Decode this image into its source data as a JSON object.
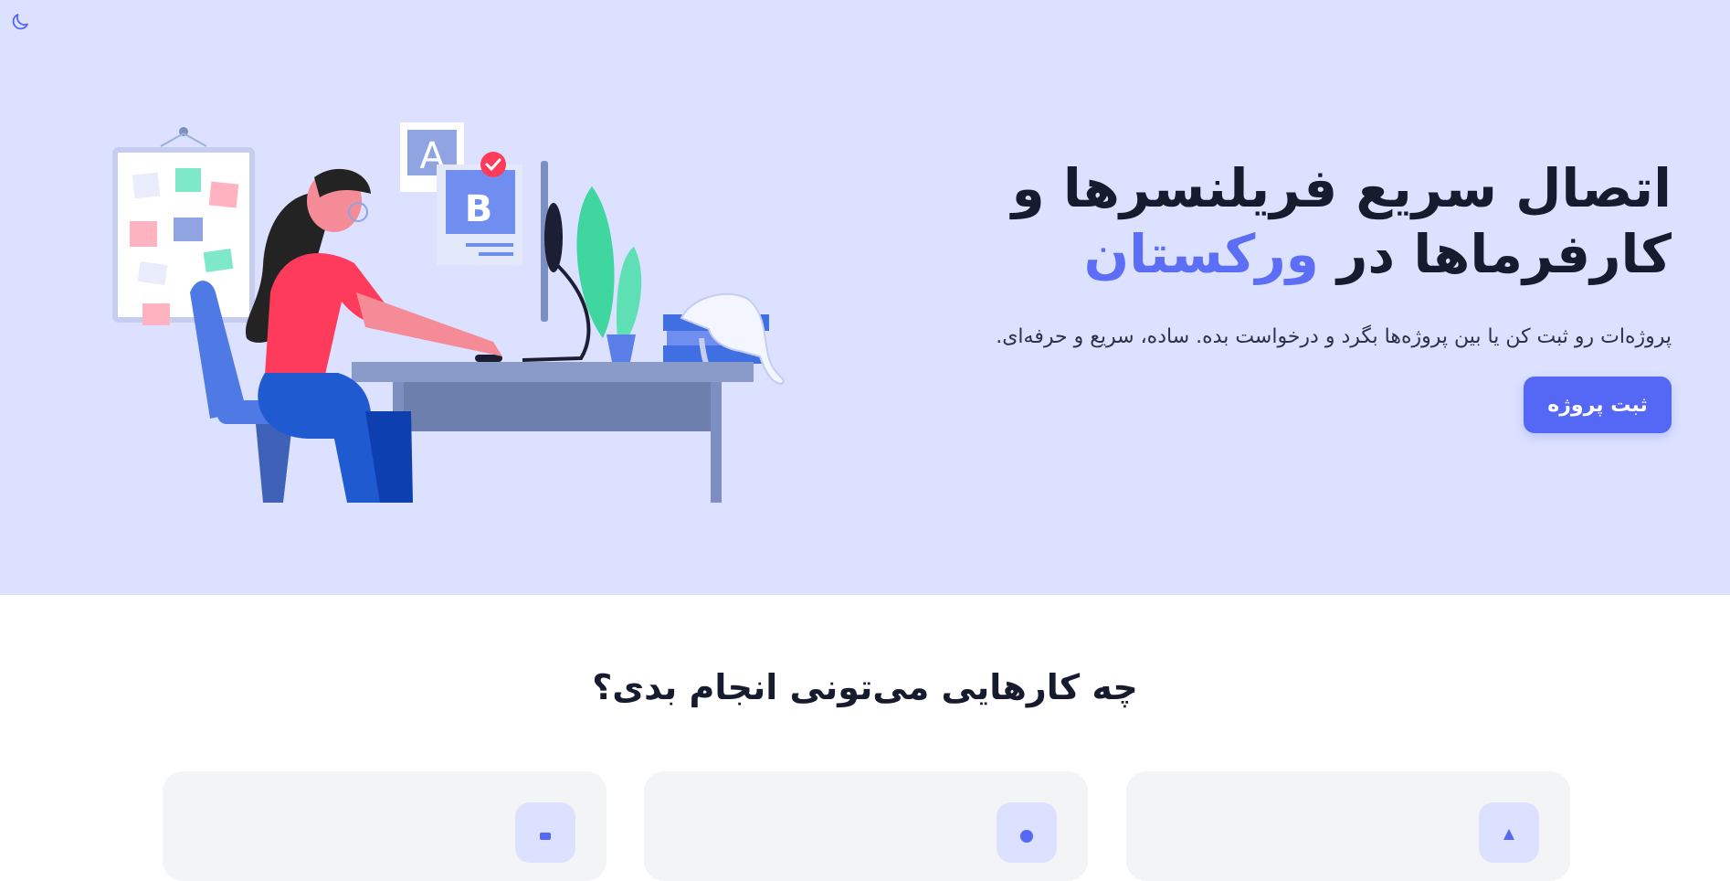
{
  "theme_toggle": {
    "icon": "moon-icon"
  },
  "hero": {
    "title_line1": "اتصال سریع فریلنسرها و",
    "title_line2_prefix": "کارفرماها در",
    "title_brand": "ورکستان",
    "subtitle": "پروژه‌ات رو ثبت کن یا بین پروژه‌ها بگرد و درخواست بده. ساده، سریع و حرفه‌ای.",
    "cta_label": "ثبت پروژه"
  },
  "features": {
    "title": "چه کارهایی می‌تونی انجام بدی؟"
  },
  "colors": {
    "hero_bg": "#dbe1ff",
    "accent": "#5567f5",
    "brand_text": "#5b6ef5",
    "heading": "#161b2e"
  }
}
